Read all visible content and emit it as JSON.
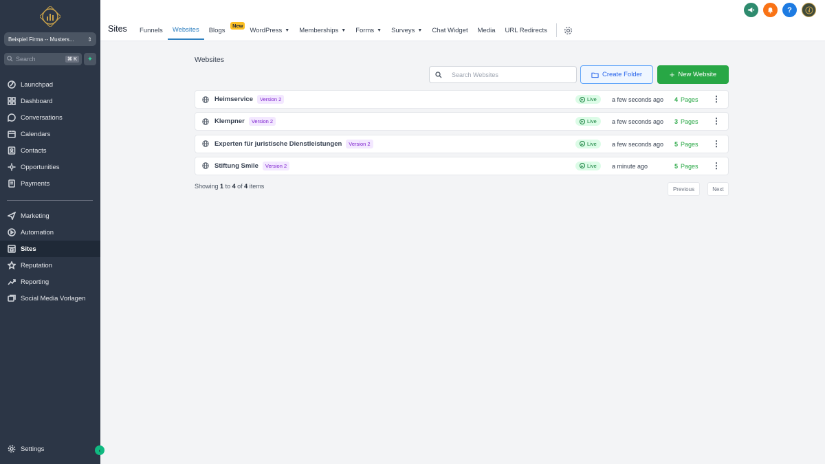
{
  "sidebar": {
    "account": "Beispiel Firma -- Musters...",
    "search_placeholder": "Search",
    "search_shortcut": "⌘ K",
    "items_top": [
      {
        "label": "Launchpad",
        "icon": "rocket-icon"
      },
      {
        "label": "Dashboard",
        "icon": "grid-icon"
      },
      {
        "label": "Conversations",
        "icon": "chat-icon"
      },
      {
        "label": "Calendars",
        "icon": "calendar-icon"
      },
      {
        "label": "Contacts",
        "icon": "contacts-icon"
      },
      {
        "label": "Opportunities",
        "icon": "opportunities-icon"
      },
      {
        "label": "Payments",
        "icon": "payments-icon"
      }
    ],
    "items_bottom": [
      {
        "label": "Marketing",
        "icon": "send-icon"
      },
      {
        "label": "Automation",
        "icon": "automation-icon"
      },
      {
        "label": "Sites",
        "icon": "sites-icon",
        "active": true
      },
      {
        "label": "Reputation",
        "icon": "star-icon"
      },
      {
        "label": "Reporting",
        "icon": "chart-icon"
      },
      {
        "label": "Social Media Vorlagen",
        "icon": "social-icon"
      }
    ],
    "settings": "Settings"
  },
  "header": {
    "title": "Sites",
    "tabs": [
      {
        "label": "Funnels"
      },
      {
        "label": "Websites",
        "active": true
      },
      {
        "label": "Blogs",
        "badge": "New"
      },
      {
        "label": "WordPress",
        "dropdown": true
      },
      {
        "label": "Memberships",
        "dropdown": true
      },
      {
        "label": "Forms",
        "dropdown": true
      },
      {
        "label": "Surveys",
        "dropdown": true
      },
      {
        "label": "Chat Widget"
      },
      {
        "label": "Media"
      },
      {
        "label": "URL Redirects"
      }
    ],
    "help": "?"
  },
  "main": {
    "title": "Websites",
    "search_placeholder": "Search Websites",
    "create_folder": "Create Folder",
    "new_website": "New Website",
    "status_label": "Live",
    "pages_label": "Pages",
    "rows": [
      {
        "name": "Heimservice",
        "version": "Version 2",
        "time": "a few seconds ago",
        "pages": "4"
      },
      {
        "name": "Klempner",
        "version": "Version 2",
        "time": "a few seconds ago",
        "pages": "3"
      },
      {
        "name": "Experten für juristische Dienstleistungen",
        "version": "Version 2",
        "time": "a few seconds ago",
        "pages": "5"
      },
      {
        "name": "Stiftung Smile",
        "version": "Version 2",
        "time": "a minute ago",
        "pages": "5"
      }
    ],
    "showing": {
      "prefix": "Showing",
      "from": "1",
      "to_word": "to",
      "to": "4",
      "of_word": "of",
      "total": "4",
      "suffix": "items"
    },
    "previous": "Previous",
    "next": "Next"
  },
  "colors": {
    "sidebar_bg": "#2c3646",
    "accent_blue": "#2f80c0",
    "green": "#28a745",
    "new_badge": "#fbbf24"
  }
}
